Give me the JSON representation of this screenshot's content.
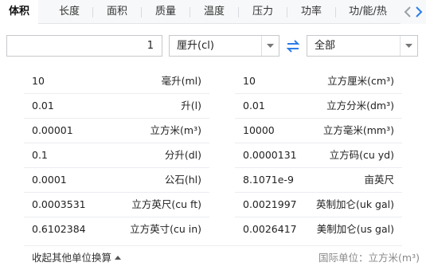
{
  "tabs": [
    {
      "label": "体积",
      "active": true
    },
    {
      "label": "长度",
      "active": false
    },
    {
      "label": "面积",
      "active": false
    },
    {
      "label": "质量",
      "active": false
    },
    {
      "label": "温度",
      "active": false
    },
    {
      "label": "压力",
      "active": false
    },
    {
      "label": "功率",
      "active": false
    },
    {
      "label": "功/能/热",
      "active": false
    }
  ],
  "tab_nav": {
    "prev_icon": "chevron-left-icon",
    "next_icon": "chevron-right-icon",
    "accent_color": "#2b7de9"
  },
  "converter": {
    "input_value": "1",
    "unit_selected": "厘升(cl)",
    "swap_icon": "swap-arrows-icon",
    "swap_color": "#2b7de9",
    "scope_selected": "全部"
  },
  "results": {
    "left": [
      {
        "value": "10",
        "unit": "毫升(ml)"
      },
      {
        "value": "0.01",
        "unit": "升(l)"
      },
      {
        "value": "0.00001",
        "unit": "立方米(m³)"
      },
      {
        "value": "0.1",
        "unit": "分升(dl)"
      },
      {
        "value": "0.0001",
        "unit": "公石(hl)"
      },
      {
        "value": "0.0003531",
        "unit": "立方英尺(cu ft)"
      },
      {
        "value": "0.6102384",
        "unit": "立方英寸(cu in)"
      }
    ],
    "right": [
      {
        "value": "10",
        "unit": "立方厘米(cm³)"
      },
      {
        "value": "0.01",
        "unit": "立方分米(dm³)"
      },
      {
        "value": "10000",
        "unit": "立方毫米(mm³)"
      },
      {
        "value": "0.0000131",
        "unit": "立方码(cu yd)"
      },
      {
        "value": "8.1071e-9",
        "unit": "亩英尺"
      },
      {
        "value": "0.0021997",
        "unit": "英制加仑(uk gal)"
      },
      {
        "value": "0.0026417",
        "unit": "美制加仑(us gal)"
      }
    ]
  },
  "footer": {
    "collapse_label": "收起其他单位换算",
    "si_unit_label": "国际单位：立方米(m³)"
  }
}
